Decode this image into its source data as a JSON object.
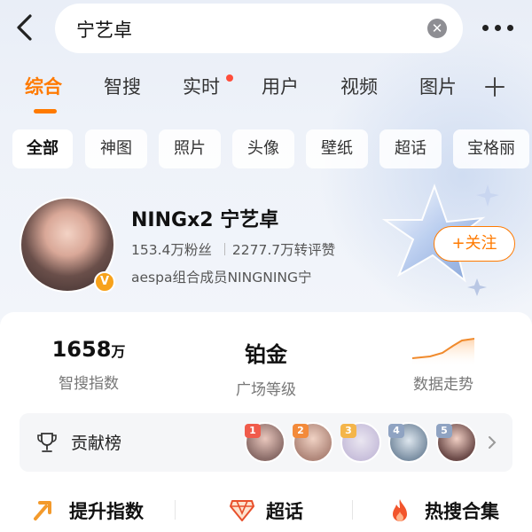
{
  "search": {
    "query": "宁艺卓"
  },
  "tabs": [
    {
      "label": "综合",
      "active": true
    },
    {
      "label": "智搜"
    },
    {
      "label": "实时",
      "has_dot": true
    },
    {
      "label": "用户"
    },
    {
      "label": "视频"
    },
    {
      "label": "图片"
    }
  ],
  "filters": [
    "全部",
    "神图",
    "照片",
    "头像",
    "壁纸",
    "超话",
    "宝格丽"
  ],
  "profile": {
    "name": "NINGx2 宁艺卓",
    "followers": "153.4万粉丝",
    "engagement": "2277.7万转评赞",
    "description": "aespa组合成员NINGNING宁",
    "badge": "V",
    "follow_label": "+关注"
  },
  "metrics": {
    "index_value": "1658",
    "index_unit": "万",
    "index_label": "智搜指数",
    "level_value": "铂金",
    "level_label": "广场等级",
    "trend_label": "数据走势"
  },
  "contribution": {
    "title": "贡献榜",
    "fans": [
      {
        "rank": "1"
      },
      {
        "rank": "2"
      },
      {
        "rank": "3"
      },
      {
        "rank": "4"
      },
      {
        "rank": "5"
      }
    ]
  },
  "actions": {
    "boost": "提升指数",
    "topic": "超话",
    "hot": "热搜合集"
  },
  "colors": {
    "accent": "#ff7a00",
    "dot": "#ff4d3a",
    "badge": "#f7a21b"
  }
}
